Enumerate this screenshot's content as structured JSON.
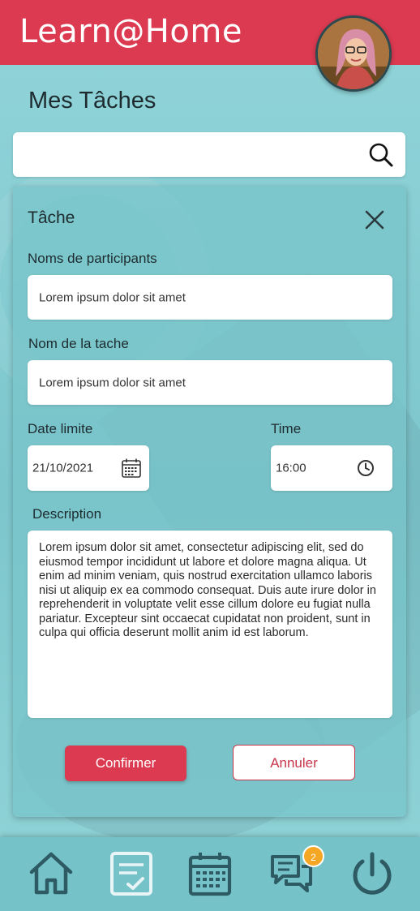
{
  "app": {
    "title": "Learn@Home"
  },
  "page": {
    "title": "Mes Tâches"
  },
  "search": {
    "value": "",
    "placeholder": ""
  },
  "modal": {
    "title": "Tâche",
    "participants": {
      "label": "Noms de participants",
      "value": "Lorem ipsum dolor sit amet"
    },
    "task_name": {
      "label": "Nom de la tache",
      "value": "Lorem ipsum dolor sit amet"
    },
    "deadline": {
      "label": "Date limite",
      "value": "21/10/2021"
    },
    "time": {
      "label": "Time",
      "value": "16:00"
    },
    "description": {
      "label": "Description",
      "value": "Lorem ipsum dolor sit amet, consectetur adipiscing elit, sed do eiusmod tempor incididunt ut labore et dolore magna aliqua. Ut enim ad minim veniam, quis nostrud exercitation ullamco laboris nisi ut aliquip ex ea commodo consequat. Duis aute irure dolor in reprehenderit in voluptate velit esse cillum dolore eu fugiat nulla pariatur. Excepteur sint occaecat cupidatat non proident, sunt in culpa qui officia deserunt mollit anim id est laborum."
    },
    "confirm_label": "Confirmer",
    "cancel_label": "Annuler"
  },
  "nav": {
    "items": [
      {
        "icon": "home-icon"
      },
      {
        "icon": "tasks-icon",
        "active": true
      },
      {
        "icon": "calendar-icon"
      },
      {
        "icon": "chat-icon"
      },
      {
        "icon": "power-icon"
      }
    ],
    "chat_badge": "2"
  },
  "colors": {
    "accent": "#dc3a51",
    "background": "#86d0d4",
    "nav_icon": "#2d5a63",
    "nav_icon_active": "#e8f4f5",
    "badge": "#f5a623"
  }
}
